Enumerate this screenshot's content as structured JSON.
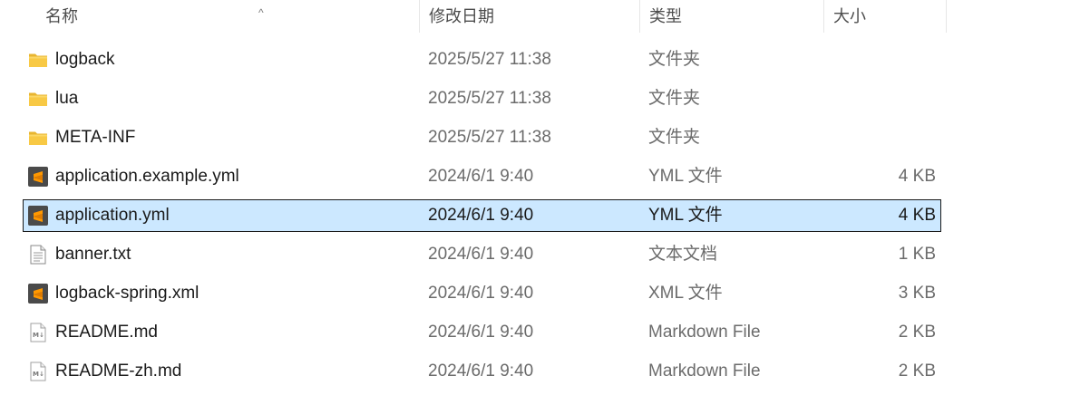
{
  "columns": {
    "name": "名称",
    "date": "修改日期",
    "type": "类型",
    "size": "大小"
  },
  "sort_indicator": "^",
  "files": [
    {
      "name": "logback",
      "date": "2025/5/27 11:38",
      "type": "文件夹",
      "size": "",
      "icon": "folder-icon"
    },
    {
      "name": "lua",
      "date": "2025/5/27 11:38",
      "type": "文件夹",
      "size": "",
      "icon": "folder-icon"
    },
    {
      "name": "META-INF",
      "date": "2025/5/27 11:38",
      "type": "文件夹",
      "size": "",
      "icon": "folder-icon"
    },
    {
      "name": "application.example.yml",
      "date": "2024/6/1 9:40",
      "type": "YML 文件",
      "size": "4 KB",
      "icon": "sublime-file-icon"
    },
    {
      "name": "application.yml",
      "date": "2024/6/1 9:40",
      "type": "YML 文件",
      "size": "4 KB",
      "icon": "sublime-file-icon",
      "selected": true
    },
    {
      "name": "banner.txt",
      "date": "2024/6/1 9:40",
      "type": "文本文档",
      "size": "1 KB",
      "icon": "text-file-icon"
    },
    {
      "name": "logback-spring.xml",
      "date": "2024/6/1 9:40",
      "type": "XML 文件",
      "size": "3 KB",
      "icon": "sublime-file-icon"
    },
    {
      "name": "README.md",
      "date": "2024/6/1 9:40",
      "type": "Markdown File",
      "size": "2 KB",
      "icon": "markdown-file-icon"
    },
    {
      "name": "README-zh.md",
      "date": "2024/6/1 9:40",
      "type": "Markdown File",
      "size": "2 KB",
      "icon": "markdown-file-icon"
    }
  ],
  "colors": {
    "selection_bg": "#cce8ff",
    "folder": "#f8c945",
    "sublime_bg": "#4a4a4a",
    "sublime_accent": "#ff9800"
  }
}
